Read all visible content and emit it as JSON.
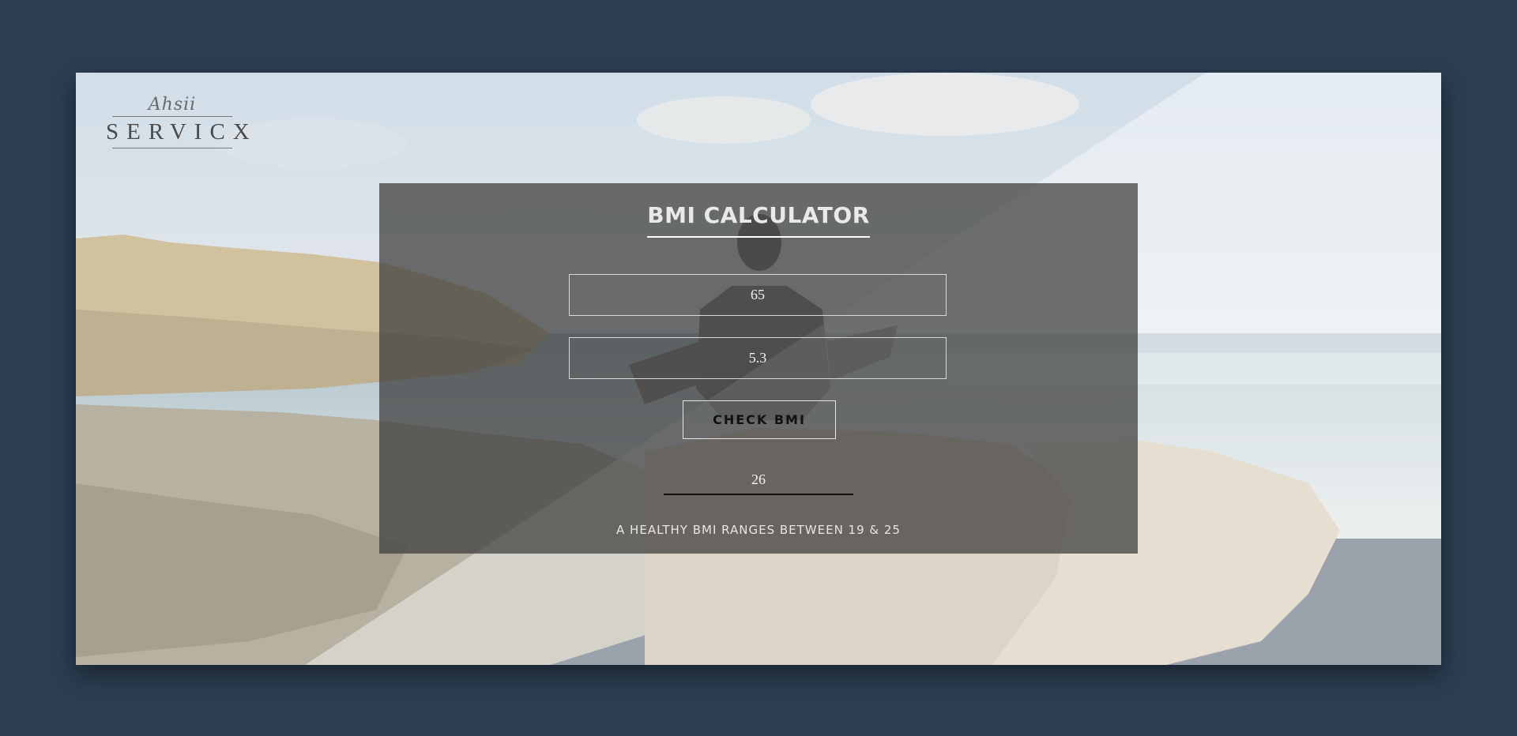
{
  "brand": {
    "script": "Ahsii",
    "name": "SERVICX"
  },
  "calculator": {
    "title": "BMI CALCULATOR",
    "weight_value": "65",
    "height_value": "5.3",
    "check_button": "CHECK BMI",
    "result_value": "26",
    "note": "A HEALTHY BMI RANGES BETWEEN 19 & 25"
  },
  "colors": {
    "page_background": "#2c3e52",
    "panel_overlay": "#3a3a3a",
    "text_light": "#e9e9e9"
  },
  "background_image": "beach-meditation-photo"
}
